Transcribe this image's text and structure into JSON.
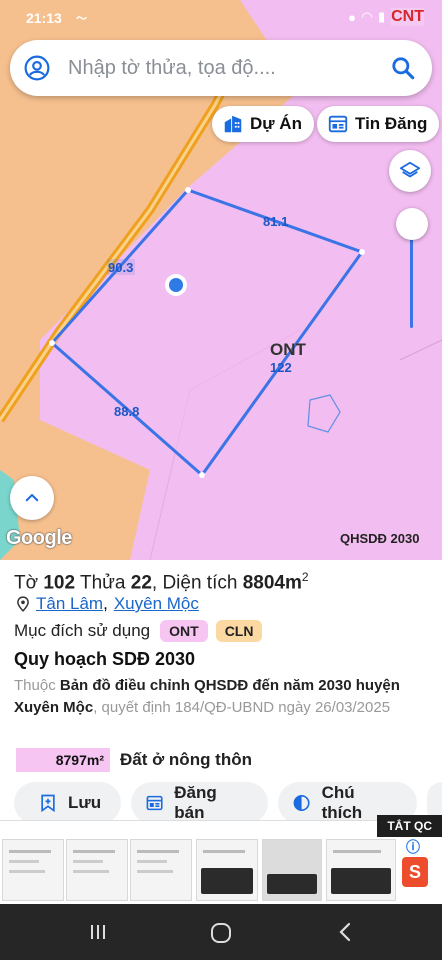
{
  "status_bar": {
    "time": "21:13",
    "brand": "CNT"
  },
  "search": {
    "placeholder": "Nhập tờ thửa, tọa độ...."
  },
  "map_buttons": {
    "du_an": "Dự Án",
    "tin_dang": "Tin Đăng"
  },
  "parcel": {
    "zone_code": "ONT",
    "zone_number": "122",
    "edge_labels": [
      "90.3",
      "81.1",
      "88.8"
    ]
  },
  "map_footer": {
    "google": "Google",
    "badge": "QHSDĐ 2030"
  },
  "info": {
    "sheet_prefix": "Tờ",
    "sheet_no": "102",
    "parcel_prefix": "Thửa",
    "parcel_no": "22",
    "area_prefix": ", Diện tích",
    "area_value": "8804m",
    "area_unit_sup": "2",
    "commune": "Tân Lâm",
    "district": "Xuyên Mộc",
    "purpose_label": "Mục đích sử dụng",
    "purpose_tags": [
      "ONT",
      "CLN"
    ],
    "plan_title": "Quy hoạch SDĐ 2030",
    "plan_desc_prefix": "Thuộc",
    "plan_desc_bold": "Bản đồ điều chỉnh QHSDĐ đến năm 2030 huyện Xuyên Mộc",
    "plan_desc_suffix": ", quyết định 184/QĐ-UBND ngày 26/03/2025",
    "area_chip": "8797m²",
    "area_chip_label": "Đất ở nông thôn"
  },
  "actions": {
    "save": "Lưu",
    "post": "Đăng bán",
    "legend": "Chú thích"
  },
  "ad": {
    "close_label": "TẮT QC"
  },
  "colors": {
    "land_orange": "#f6c08e",
    "land_pink": "#f2bdf0",
    "parcel_border": "#3b74e6",
    "road": "#f0a020"
  }
}
